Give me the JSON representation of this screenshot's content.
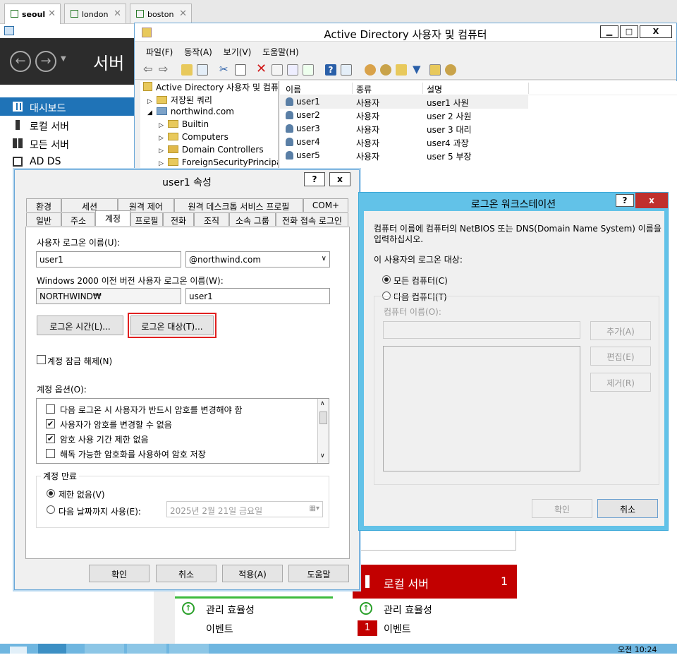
{
  "vm_tabs": [
    {
      "label": "seoul"
    },
    {
      "label": "london"
    },
    {
      "label": "boston"
    }
  ],
  "server_manager": {
    "title": "서버",
    "nav": [
      {
        "label": "대시보드"
      },
      {
        "label": "로컬 서버"
      },
      {
        "label": "모든 서버"
      },
      {
        "label": "AD DS"
      }
    ]
  },
  "adu": {
    "title": "Active Directory 사용자 및 컴퓨터",
    "menu": [
      "파일(F)",
      "동작(A)",
      "보기(V)",
      "도움말(H)"
    ],
    "tree": [
      "Active Directory 사용자 및 컴퓨",
      "저장된 쿼리",
      "northwind.com",
      "Builtin",
      "Computers",
      "Domain Controllers",
      "ForeignSecurityPrincipal"
    ],
    "list_headers": [
      "이름",
      "종류",
      "설명"
    ],
    "rows": [
      {
        "name": "user1",
        "type": "사용자",
        "desc": "user1 사원"
      },
      {
        "name": "user2",
        "type": "사용자",
        "desc": "user 2 사원"
      },
      {
        "name": "user3",
        "type": "사용자",
        "desc": "user 3 대리"
      },
      {
        "name": "user4",
        "type": "사용자",
        "desc": "user4 과장"
      },
      {
        "name": "user5",
        "type": "사용자",
        "desc": "user 5 부장"
      }
    ]
  },
  "props": {
    "title": "user1 속성",
    "help": "?",
    "close": "x",
    "tabs_top": [
      "환경",
      "세션",
      "원격 제어",
      "원격 데스크톱 서비스 프로필",
      "COM+"
    ],
    "tabs_bottom": [
      "일반",
      "주소",
      "계정",
      "프로필",
      "전화",
      "조직",
      "소속 그룹",
      "전화 접속 로그인"
    ],
    "logon_name_label": "사용자 로그온 이름(U):",
    "logon_name": "user1",
    "domain": "@northwind.com",
    "pre2000_label": "Windows 2000 이전 버전 사용자 로그온 이름(W):",
    "netbios": "NORTHWIND₩",
    "pre2000_name": "user1",
    "logon_hours_btn": "로그온 시간(L)...",
    "logon_to_btn": "로그온 대상(T)...",
    "unlock_label": "계정 잠금 해제(N)",
    "options_label": "계정 옵션(O):",
    "options": [
      {
        "label": "다음 로그온 시 사용자가 반드시 암호를 변경해야 함",
        "checked": false
      },
      {
        "label": "사용자가 암호를 변경할 수 없음",
        "checked": true
      },
      {
        "label": "암호 사용 기간 제한 없음",
        "checked": true
      },
      {
        "label": "해독 가능한 암호화를 사용하여 암호 저장",
        "checked": false
      }
    ],
    "expire_label": "계정 만료",
    "never_label": "제한 없음(V)",
    "until_label": "다음 날짜까지 사용(E):",
    "date_value": "2025년   2월 21일 금요일",
    "buttons": [
      "확인",
      "취소",
      "적용(A)",
      "도움말"
    ]
  },
  "lws": {
    "title": "로그온 워크스테이션",
    "help": "?",
    "close": "x",
    "desc": "컴퓨터 이름에 컴퓨터의 NetBIOS 또는 DNS(Domain Name System) 이름을 입력하십시오.",
    "target_label": "이 사용자의 로그온 대상:",
    "all_label": "모든 컴퓨터(C)",
    "following_label": "다음 컴퓨터(T)",
    "computer_name_label": "컴퓨터 이름(O):",
    "add_btn": "추가(A)",
    "edit_btn": "편집(E)",
    "remove_btn": "제거(R)",
    "ok_btn": "확인",
    "cancel_btn": "취소"
  },
  "tiles": {
    "local_server": "로컬 서버",
    "local_count": "1",
    "mgmt": "관리 효율성",
    "events": "이벤트",
    "event_badge": "1"
  },
  "taskbar": {
    "clock": "오전 10:24"
  }
}
